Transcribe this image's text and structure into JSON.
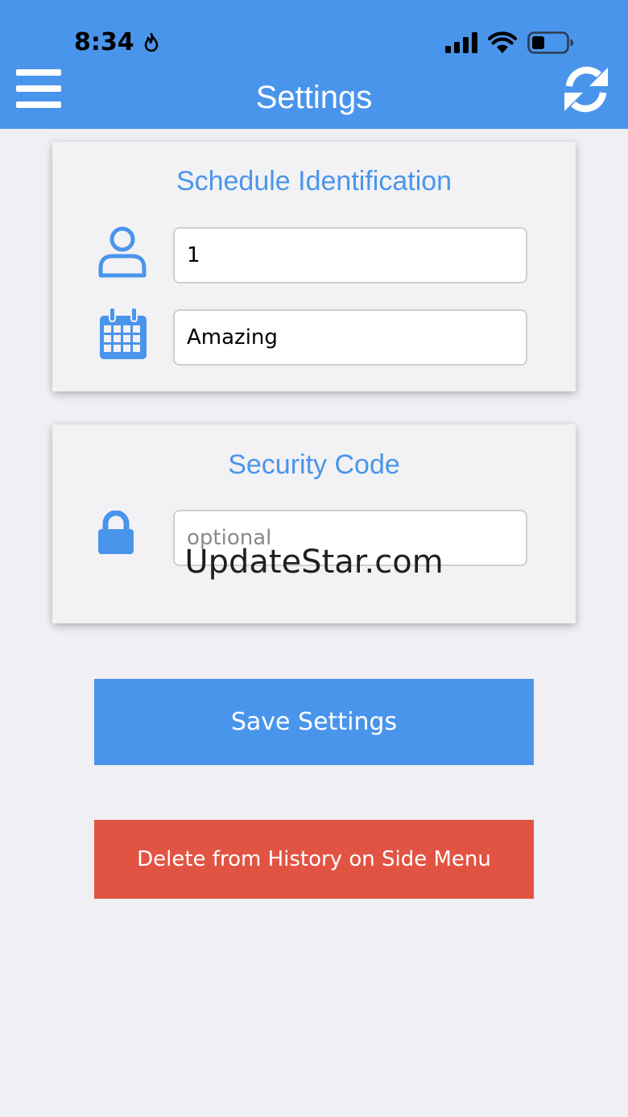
{
  "status_bar": {
    "time": "8:34",
    "icons": [
      "flame-icon",
      "cellular-signal-icon",
      "wifi-icon",
      "battery-icon"
    ]
  },
  "header": {
    "title": "Settings",
    "menu_icon": "hamburger-menu-icon",
    "refresh_icon": "refresh-icon"
  },
  "schedule_card": {
    "title": "Schedule Identification",
    "user_field": {
      "value": "1",
      "icon": "user-icon"
    },
    "schedule_field": {
      "value": "Amazing",
      "icon": "calendar-icon"
    }
  },
  "security_card": {
    "title": "Security Code",
    "code_field": {
      "value": "",
      "placeholder": "optional",
      "icon": "lock-icon"
    }
  },
  "buttons": {
    "save_label": "Save Settings",
    "delete_label": "Delete from History on Side Menu"
  },
  "watermark": "UpdateStar.com",
  "colors": {
    "header": "#4a95ec",
    "accent": "#4a95ec",
    "danger": "#e15444",
    "background": "#efeff4",
    "card": "#f2f2f4"
  }
}
